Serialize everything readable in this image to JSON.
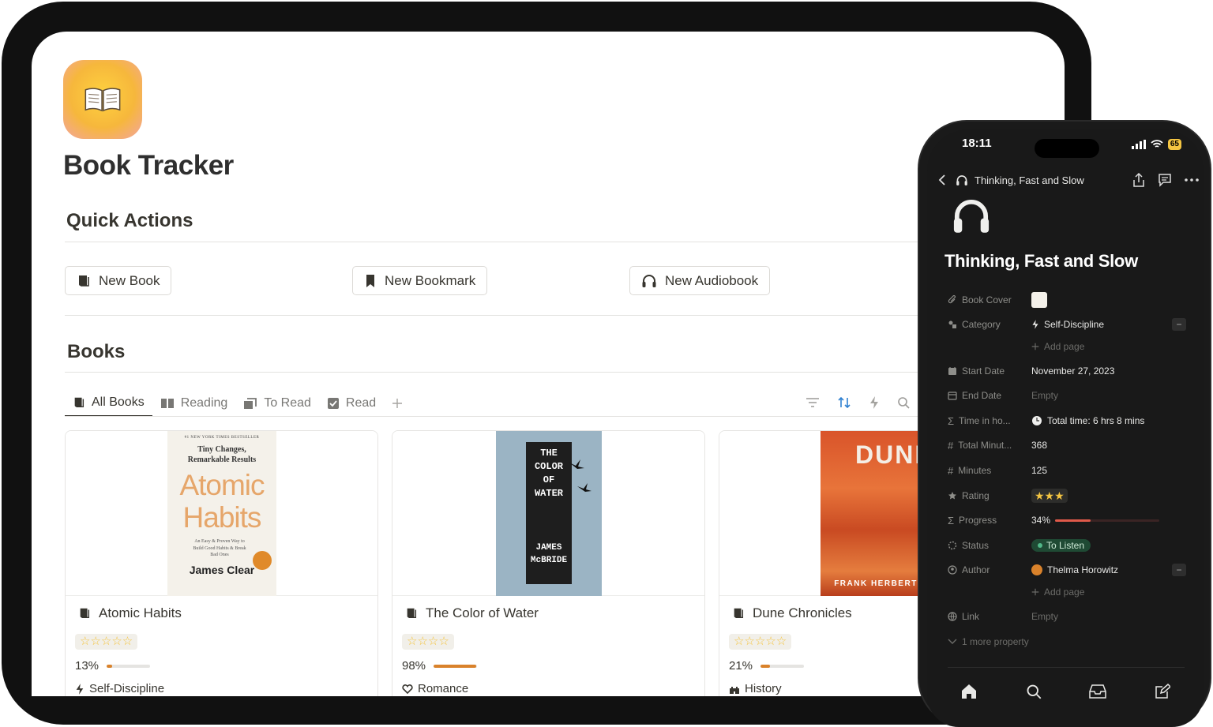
{
  "tablet": {
    "page_title": "Book Tracker",
    "quick_actions": {
      "heading": "Quick Actions",
      "buttons": [
        {
          "label": "New Book",
          "icon": "book-icon"
        },
        {
          "label": "New Bookmark",
          "icon": "bookmark-icon"
        },
        {
          "label": "New Audiobook",
          "icon": "headphones-icon"
        }
      ]
    },
    "books": {
      "heading": "Books",
      "tabs": [
        {
          "label": "All Books",
          "icon": "book-icon",
          "active": true
        },
        {
          "label": "Reading",
          "icon": "open-book-icon",
          "active": false
        },
        {
          "label": "To Read",
          "icon": "books-stack-icon",
          "active": false
        },
        {
          "label": "Read",
          "icon": "checkbox-icon",
          "active": false
        }
      ],
      "cards": [
        {
          "title": "Atomic Habits",
          "stars": "☆☆☆☆☆",
          "progress_text": "13%",
          "progress": 0.13,
          "category": "Self-Discipline",
          "category_icon": "lightning-icon",
          "cover": {
            "kicker": "#1 NEW YORK TIMES BESTSELLER",
            "tagline": "Tiny Changes, Remarkable Results",
            "title_line1": "Atomic",
            "title_line2": "Habits",
            "subtitle": "An Easy & Proven Way to Build Good Habits & Break Bad Ones",
            "author": "James Clear"
          }
        },
        {
          "title": "The Color of Water",
          "stars": "☆☆☆☆",
          "progress_text": "98%",
          "progress": 0.98,
          "category": "Romance",
          "category_icon": "heart-icon",
          "cover": {
            "title_lines": [
              "THE",
              "COLOR",
              "OF",
              "WATER"
            ],
            "author_lines": [
              "JAMES",
              "McBRIDE"
            ]
          }
        },
        {
          "title": "Dune Chronicles",
          "stars": "☆☆☆☆☆",
          "progress_text": "21%",
          "progress": 0.21,
          "category": "History",
          "category_icon": "castle-icon",
          "cover": {
            "title": "DUNE",
            "author": "FRANK HERBERT"
          }
        }
      ]
    }
  },
  "phone": {
    "time": "18:11",
    "battery": "65",
    "nav_title": "Thinking, Fast and Slow",
    "page_title": "Thinking, Fast and Slow",
    "properties": {
      "book_cover": {
        "label": "Book Cover"
      },
      "category": {
        "label": "Category",
        "value": "Self-Discipline",
        "add": "Add page"
      },
      "start_date": {
        "label": "Start Date",
        "value": "November 27, 2023"
      },
      "end_date": {
        "label": "End Date",
        "value": "Empty"
      },
      "time_in_hours": {
        "label": "Time in ho...",
        "value": "Total time: 6 hrs 8 mins"
      },
      "total_minutes": {
        "label": "Total Minut...",
        "value": "368"
      },
      "minutes": {
        "label": "Minutes",
        "value": "125"
      },
      "rating": {
        "label": "Rating",
        "value": "★★★"
      },
      "progress": {
        "label": "Progress",
        "value": "34%",
        "fraction": 0.34
      },
      "status": {
        "label": "Status",
        "value": "To Listen"
      },
      "author": {
        "label": "Author",
        "value": "Thelma Horowitz",
        "add": "Add page"
      },
      "link": {
        "label": "Link",
        "value": "Empty"
      },
      "more": {
        "label": "1 more property"
      }
    }
  },
  "colors": {
    "progress_tablet": "#d9822b",
    "progress_phone": "#e05a4a",
    "status_green": "#1f4a34",
    "star": "#f4c542"
  }
}
